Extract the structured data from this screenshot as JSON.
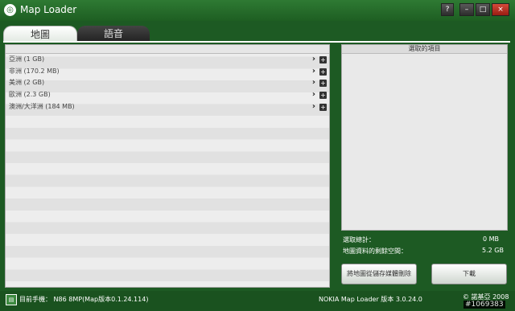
{
  "window": {
    "title": "Map Loader",
    "help": "?",
    "min": "–",
    "max": "□",
    "close": "×"
  },
  "tabs": [
    {
      "label": "地圖"
    },
    {
      "label": "語音"
    }
  ],
  "map_list": {
    "items": [
      {
        "label": "亞洲 (1 GB)"
      },
      {
        "label": "非洲 (170.2 MB)"
      },
      {
        "label": "美洲 (2 GB)"
      },
      {
        "label": "歐洲 (2.3 GB)"
      },
      {
        "label": "澳洲/大洋洲 (184 MB)"
      }
    ],
    "chev": "›",
    "plus": "+"
  },
  "selected_panel": {
    "header": "選取的項目"
  },
  "stats": {
    "selected_total_label": "選取總計：",
    "selected_total_value": "0 MB",
    "space_label": "地圖資料的剩餘空間：",
    "space_value": "5.2 GB"
  },
  "buttons": {
    "remove": "將地圖從儲存媒體刪除",
    "download": "下載"
  },
  "statusbar": {
    "device": "目前手機：  N86 8MP(Map版本0.1.24.114)",
    "version": "NOKIA Map Loader 版本 3.0.24.0",
    "copyright": "© 諾基亞 2008"
  },
  "watermark": "#1069383"
}
